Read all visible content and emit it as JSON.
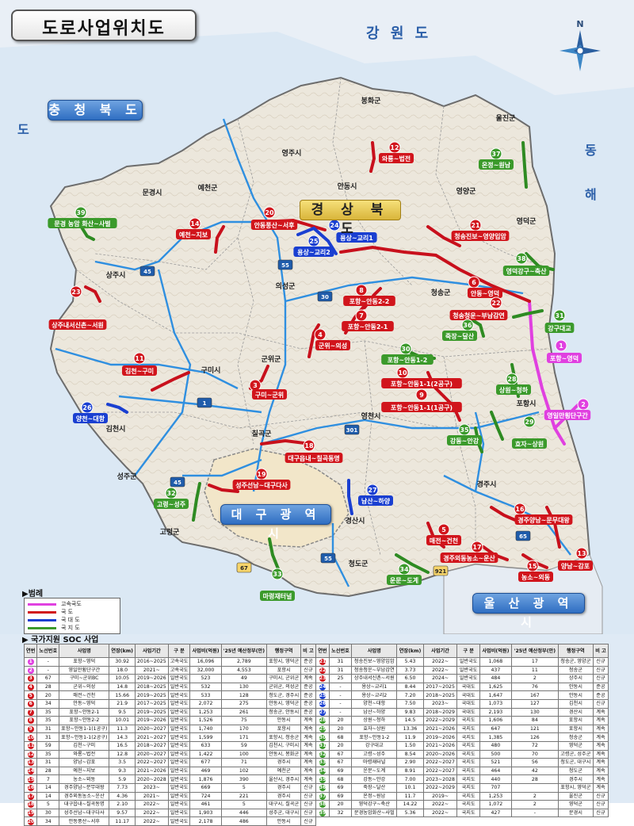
{
  "title": "도로사업위치도",
  "colors": {
    "expressway": "#e040e0",
    "national": "#d1151c",
    "national_support": "#1a3fd1",
    "local": "#3b9a2b",
    "expressway_line": "#2f8fe0",
    "province_fill": "#f4f1ea",
    "sea": "#cfe2f3"
  },
  "regions": {
    "gangwon": "강 원 도",
    "chungbuk": "충 청 북 도",
    "gyeongbuk": "경 상 북 도",
    "daegu": "대 구 광 역 시",
    "ulsan": "울 산 광 역 시",
    "east_sea": [
      "동",
      "해"
    ],
    "do_side": "도",
    "busan_dim": "울산광역시"
  },
  "compass": {
    "north": "N"
  },
  "places": [
    "봉화군",
    "영주시",
    "예천군",
    "안동시",
    "영양군",
    "울진군",
    "문경시",
    "영덕군",
    "상주시",
    "의성군",
    "청송군",
    "구미시",
    "군위군",
    "김천시",
    "칠곡군",
    "영천시",
    "포항시",
    "성주군",
    "고령군",
    "경산시",
    "청도군",
    "경주시"
  ],
  "projects": [
    {
      "no": "1",
      "label": "포항~영덕",
      "cls": "exp"
    },
    {
      "no": "2",
      "label": "영일만횡단구간",
      "cls": "exp"
    },
    {
      "no": "3",
      "label": "구미~군위",
      "cls": "nat"
    },
    {
      "no": "4",
      "label": "군위~의성",
      "cls": "nat"
    },
    {
      "no": "5",
      "label": "매전~건천",
      "cls": "nat"
    },
    {
      "no": "6",
      "label": "안동~영덕",
      "cls": "nat"
    },
    {
      "no": "7",
      "label": "포항~안동2-1",
      "cls": "nat"
    },
    {
      "no": "8",
      "label": "포항~안동2-2",
      "cls": "nat"
    },
    {
      "no": "9",
      "label": "포항~안동1-1(1공구)",
      "cls": "nat"
    },
    {
      "no": "10",
      "label": "포항~안동1-1(2공구)",
      "cls": "nat"
    },
    {
      "no": "11",
      "label": "김천~구미",
      "cls": "nat"
    },
    {
      "no": "12",
      "label": "와룡~법전",
      "cls": "nat"
    },
    {
      "no": "13",
      "label": "양남~감포",
      "cls": "nat"
    },
    {
      "no": "14",
      "label": "예천~지보",
      "cls": "nat"
    },
    {
      "no": "15",
      "label": "농소~외동",
      "cls": "nat"
    },
    {
      "no": "16",
      "label": "경주양남~문무대왕",
      "cls": "nat"
    },
    {
      "no": "17",
      "label": "경주외동농소~운산",
      "cls": "nat"
    },
    {
      "no": "18",
      "label": "대구읍내~칠곡동명",
      "cls": "nat"
    },
    {
      "no": "19",
      "label": "성주선남~대구다사",
      "cls": "nat"
    },
    {
      "no": "20",
      "label": "안동풍산~서후",
      "cls": "nat"
    },
    {
      "no": "21",
      "label": "청송진보~영양입암",
      "cls": "nat"
    },
    {
      "no": "22",
      "label": "청송청운~부남감연",
      "cls": "nat"
    },
    {
      "no": "23",
      "label": "상주내서신촌~서원",
      "cls": "nat"
    },
    {
      "no": "24",
      "label": "용상~교리1",
      "cls": "sup"
    },
    {
      "no": "25",
      "label": "용상~교리2",
      "cls": "sup"
    },
    {
      "no": "26",
      "label": "양천~대항",
      "cls": "sup"
    },
    {
      "no": "27",
      "label": "남산~하양",
      "cls": "sup"
    },
    {
      "no": "28",
      "label": "상원~청하",
      "cls": "loc"
    },
    {
      "no": "29",
      "label": "효자~상원",
      "cls": "loc"
    },
    {
      "no": "30",
      "label": "포항~안동1-2",
      "cls": "loc"
    },
    {
      "no": "31",
      "label": "강구대교",
      "cls": "loc"
    },
    {
      "no": "32",
      "label": "고령~성주",
      "cls": "loc"
    },
    {
      "no": "33",
      "label": "마령재터널",
      "cls": "loc"
    },
    {
      "no": "34",
      "label": "운문~도계",
      "cls": "loc"
    },
    {
      "no": "35",
      "label": "강동~안강",
      "cls": "loc"
    },
    {
      "no": "36",
      "label": "죽장~달산",
      "cls": "loc"
    },
    {
      "no": "37",
      "label": "온정~원남",
      "cls": "loc"
    },
    {
      "no": "38",
      "label": "영덕강구~축산",
      "cls": "loc"
    },
    {
      "no": "39",
      "label": "문경 농암 화산~사벌",
      "cls": "loc"
    }
  ],
  "route_shields": [
    "45",
    "55",
    "30",
    "1",
    "301",
    "45",
    "55",
    "65",
    "67",
    "921"
  ],
  "legend": {
    "title": "▶범례",
    "items": [
      "고속국도",
      "국    도",
      "국 대 도",
      "국 지 도"
    ]
  },
  "soc": {
    "title": "▶ 국가지원 SOC 사업",
    "headers": [
      "연번",
      "노선번호",
      "사업명",
      "연장(km)",
      "사업기간",
      "구 분",
      "사업비(억원)",
      "'25년 예산정부(안)",
      "행정구역",
      "비 고"
    ],
    "left_rows": [
      [
        "1",
        "-",
        "포항~영덕",
        "30.92",
        "2016~2025",
        "고속국도",
        "16,096",
        "2,789",
        "포항시, 영덕군",
        "준공"
      ],
      [
        "2",
        "-",
        "영일만횡단구간",
        "18.0",
        "2021~",
        "고속국도",
        "32,000",
        "4,553",
        "포항시",
        "신규"
      ],
      [
        "3",
        "67",
        "구미~군위BC",
        "10.05",
        "2019~2026",
        "일반국도",
        "523",
        "49",
        "구미시, 군위군",
        "계속"
      ],
      [
        "4",
        "28",
        "군위~의성",
        "14.8",
        "2018~2025",
        "일반국도",
        "532",
        "130",
        "군위군, 의성군",
        "준공"
      ],
      [
        "5",
        "20",
        "매전~건천",
        "15.66",
        "2019~2025",
        "일반국도",
        "533",
        "128",
        "청도군, 경주시",
        "준공"
      ],
      [
        "6",
        "34",
        "안동~영덕",
        "21.9",
        "2017~2025",
        "일반국도",
        "2,072",
        "275",
        "안동시, 영덕군",
        "준공"
      ],
      [
        "7",
        "35",
        "포항~안동2-1",
        "9.5",
        "2019~2025",
        "일반국도",
        "1,253",
        "261",
        "청송군, 안동시",
        "준공"
      ],
      [
        "8",
        "35",
        "포항~안동2-2",
        "10.01",
        "2019~2026",
        "일반국도",
        "1,526",
        "75",
        "안동시",
        "계속"
      ],
      [
        "9",
        "31",
        "포항~안동1-1(1공구)",
        "11.3",
        "2020~2027",
        "일반국도",
        "1,740",
        "170",
        "포항시",
        "계속"
      ],
      [
        "10",
        "31",
        "포항~안동1-1(2공구)",
        "14.3",
        "2021~2027",
        "일반국도",
        "1,599",
        "171",
        "포항시, 청송군",
        "계속"
      ],
      [
        "11",
        "59",
        "김천~구미",
        "16.5",
        "2018~2027",
        "일반국도",
        "633",
        "59",
        "김천시, 구미시",
        "계속"
      ],
      [
        "12",
        "35",
        "와룡~법전",
        "12.8",
        "2020~2027",
        "일반국도",
        "1,422",
        "100",
        "안동시, 봉화군",
        "계속"
      ],
      [
        "13",
        "31",
        "양남~감포",
        "3.5",
        "2022~2027",
        "일반국도",
        "677",
        "71",
        "경주시",
        "계속"
      ],
      [
        "14",
        "28",
        "예천~지보",
        "9.3",
        "2021~2026",
        "일반국도",
        "469",
        "102",
        "예천군",
        "계속"
      ],
      [
        "15",
        "7",
        "농소~외동",
        "5.9",
        "2020~2028",
        "일반국도",
        "1,876",
        "390",
        "울산시, 경주시",
        "계속"
      ],
      [
        "16",
        "14",
        "경주양남~문무대왕",
        "7.73",
        "2023~",
        "일반국도",
        "669",
        "5",
        "경주시",
        "신규"
      ],
      [
        "17",
        "14",
        "경주외동농소~운산",
        "4.36",
        "2021~",
        "일반국도",
        "724",
        "221",
        "경주시",
        "신규"
      ],
      [
        "18",
        "5",
        "대구읍내~칠곡동명",
        "2.10",
        "2022~",
        "일반국도",
        "461",
        "5",
        "대구시, 칠곡군",
        "신규"
      ],
      [
        "19",
        "30",
        "성주선남~대구다사",
        "9.57",
        "2022~",
        "일반국도",
        "1,903",
        "446",
        "성주군, 대구시",
        "신규"
      ],
      [
        "20",
        "34",
        "안동풍산~서후",
        "11.17",
        "2022~",
        "일반국도",
        "2,178",
        "486",
        "안동시",
        "신규"
      ]
    ],
    "right_rows": [
      [
        "21",
        "31",
        "청송진보~영양입암",
        "5.43",
        "2022~",
        "일반국도",
        "1,068",
        "17",
        "청송군, 영양군",
        "신규"
      ],
      [
        "22",
        "31",
        "청송청운~부남감연",
        "3.73",
        "2022~",
        "일반국도",
        "437",
        "11",
        "청송군",
        "신규"
      ],
      [
        "23",
        "25",
        "상주내서신촌~서원",
        "6.50",
        "2024~",
        "일반국도",
        "484",
        "2",
        "상주시",
        "신규"
      ],
      [
        "24",
        "-",
        "용상~교리1",
        "8.44",
        "2017~2025",
        "국대도",
        "1,625",
        "76",
        "안동시",
        "준공"
      ],
      [
        "25",
        "-",
        "용상~교리2",
        "7.20",
        "2018~2025",
        "국대도",
        "1,647",
        "167",
        "안동시",
        "준공"
      ],
      [
        "26",
        "-",
        "양천~대항",
        "7.50",
        "2023~",
        "국대도",
        "1,073",
        "127",
        "김천시",
        "신규"
      ],
      [
        "27",
        "-",
        "남산~하양",
        "9.83",
        "2018~2029",
        "국대도",
        "2,193",
        "130",
        "경산시",
        "계속"
      ],
      [
        "28",
        "20",
        "상원~청하",
        "14.5",
        "2022~2029",
        "국지도",
        "1,606",
        "84",
        "포항시",
        "계속"
      ],
      [
        "29",
        "20",
        "효자~상원",
        "13.36",
        "2021~2026",
        "국지도",
        "647",
        "121",
        "포항시",
        "계속"
      ],
      [
        "30",
        "68",
        "포항~안동1-2",
        "11.9",
        "2019~2026",
        "국지도",
        "1,385",
        "126",
        "청송군",
        "계속"
      ],
      [
        "31",
        "20",
        "강구대교",
        "1.50",
        "2021~2026",
        "국지도",
        "480",
        "72",
        "영덕군",
        "계속"
      ],
      [
        "32",
        "67",
        "고령~성주",
        "8.54",
        "2020~2026",
        "국지도",
        "500",
        "70",
        "고령군, 성주군",
        "계속"
      ],
      [
        "33",
        "67",
        "마령재터널",
        "2.90",
        "2022~2027",
        "국지도",
        "521",
        "56",
        "청도군, 대구시",
        "계속"
      ],
      [
        "34",
        "69",
        "운문~도계",
        "8.91",
        "2022~2027",
        "국지도",
        "464",
        "42",
        "청도군",
        "계속"
      ],
      [
        "35",
        "68",
        "강동~안강",
        "7.00",
        "2023~2028",
        "국지도",
        "440",
        "28",
        "경주시",
        "계속"
      ],
      [
        "36",
        "69",
        "죽장~달산",
        "10.1",
        "2022~2029",
        "국지도",
        "707",
        "",
        "포항시, 영덕군",
        "계속"
      ],
      [
        "37",
        "69",
        "온정~원남",
        "11.7",
        "2019~",
        "국지도",
        "1,253",
        "2",
        "울진군",
        "신규"
      ],
      [
        "38",
        "20",
        "영덕강구~축산",
        "14.22",
        "2022~",
        "국지도",
        "1,072",
        "2",
        "영덕군",
        "신규"
      ],
      [
        "39",
        "32",
        "문경농암화산~사벌",
        "5.36",
        "2022~",
        "국지도",
        "427",
        "-",
        "문경시",
        "신규"
      ]
    ]
  }
}
